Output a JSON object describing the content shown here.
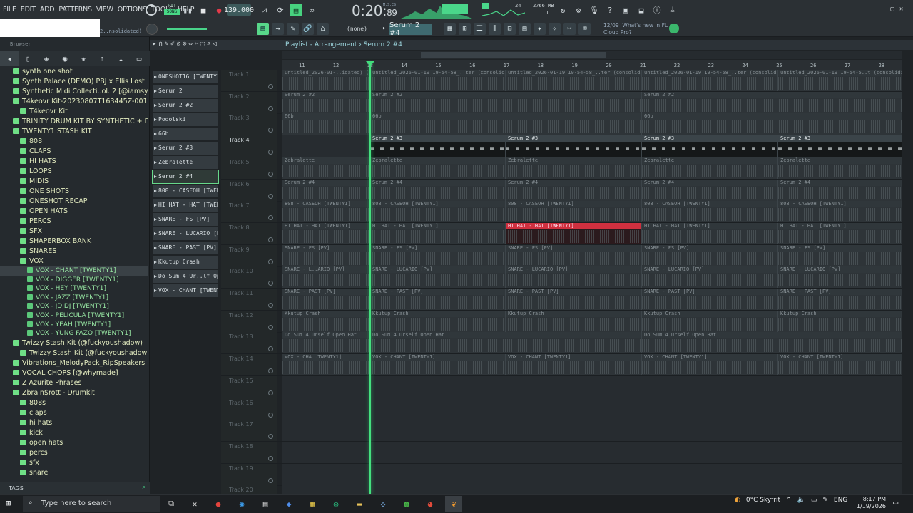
{
  "menu": [
    "FILE",
    "EDIT",
    "ADD",
    "PATTERNS",
    "VIEW",
    "OPTIONS",
    "TOOLS",
    "HELP"
  ],
  "transport": {
    "pat_label": "PAT",
    "song_label": "SONG",
    "tempo": "139.000",
    "time_main": "0:20",
    "time_sub": "89",
    "time_unit": "M:S:CS",
    "cpu_value": "24",
    "ram": "2766 MB",
    "voices": "1"
  },
  "pattern": {
    "selected": "Serum 2 #4",
    "none_label": "(none)"
  },
  "news": {
    "date": "12/09",
    "line1": "What's new in FL",
    "line2": "Cloud Pro?"
  },
  "browser": {
    "title": "Browser",
    "partial_text": "2..nsolidated)",
    "tags_label": "TAGS",
    "items": [
      {
        "label": "synth one shot",
        "indent": 1,
        "type": "folder"
      },
      {
        "label": "Synth Palace (DEMO) PBJ x Ellis Lost",
        "indent": 1,
        "type": "folder"
      },
      {
        "label": "Synthetic Midi Collecti..ol. 2 [@iamsynthetic]",
        "indent": 1,
        "type": "folder"
      },
      {
        "label": "T4keovr Kit-20230807T163445Z-001",
        "indent": 1,
        "type": "folder"
      },
      {
        "label": "T4keovr Kit",
        "indent": 2,
        "type": "folder"
      },
      {
        "label": "TRINITY DRUM KIT BY SYNTHETIC + DYNOX",
        "indent": 1,
        "type": "folder"
      },
      {
        "label": "TWENTY1 STASH KIT",
        "indent": 1,
        "type": "folder"
      },
      {
        "label": "808",
        "indent": 2,
        "type": "folder"
      },
      {
        "label": "CLAPS",
        "indent": 2,
        "type": "folder"
      },
      {
        "label": "HI HATS",
        "indent": 2,
        "type": "folder"
      },
      {
        "label": "LOOPS",
        "indent": 2,
        "type": "folder"
      },
      {
        "label": "MIDIS",
        "indent": 2,
        "type": "folder"
      },
      {
        "label": "ONE SHOTS",
        "indent": 2,
        "type": "folder"
      },
      {
        "label": "ONESHOT RECAP",
        "indent": 2,
        "type": "folder"
      },
      {
        "label": "OPEN HATS",
        "indent": 2,
        "type": "folder"
      },
      {
        "label": "PERCS",
        "indent": 2,
        "type": "folder"
      },
      {
        "label": "SFX",
        "indent": 2,
        "type": "folder"
      },
      {
        "label": "SHAPERBOX BANK",
        "indent": 2,
        "type": "folder"
      },
      {
        "label": "SNARES",
        "indent": 2,
        "type": "folder"
      },
      {
        "label": "VOX",
        "indent": 2,
        "type": "folder"
      },
      {
        "label": "VOX - CHANT [TWENTY1]",
        "indent": 3,
        "type": "file",
        "selected": true
      },
      {
        "label": "VOX - DIGGER [TWENTY1]",
        "indent": 3,
        "type": "file"
      },
      {
        "label": "VOX - HEY [TWENTY1]",
        "indent": 3,
        "type": "file"
      },
      {
        "label": "VOX - JAZZ [TWENTY1]",
        "indent": 3,
        "type": "file"
      },
      {
        "label": "VOX - JDJDJ [TWENTY1]",
        "indent": 3,
        "type": "file"
      },
      {
        "label": "VOX - PELICULA [TWENTY1]",
        "indent": 3,
        "type": "file"
      },
      {
        "label": "VOX - YEAH [TWENTY1]",
        "indent": 3,
        "type": "file"
      },
      {
        "label": "VOX - YUNG FAZO [TWENTY1]",
        "indent": 3,
        "type": "file"
      },
      {
        "label": "Twizzy Stash Kit (@fuckyoushadow)",
        "indent": 1,
        "type": "folder"
      },
      {
        "label": "Twizzy Stash Kit (@fuckyoushadow)",
        "indent": 2,
        "type": "folder"
      },
      {
        "label": "Vibrations_MelodyPack_RipSpeakers",
        "indent": 1,
        "type": "folder"
      },
      {
        "label": "VOCAL CHOPS [@whymade]",
        "indent": 1,
        "type": "folder"
      },
      {
        "label": "Z Azurite Phrases",
        "indent": 1,
        "type": "folder"
      },
      {
        "label": "Zbrain$rott - Drumkit",
        "indent": 1,
        "type": "folder"
      },
      {
        "label": "808s",
        "indent": 2,
        "type": "folder"
      },
      {
        "label": "claps",
        "indent": 2,
        "type": "folder"
      },
      {
        "label": "hi hats",
        "indent": 2,
        "type": "folder"
      },
      {
        "label": "kick",
        "indent": 2,
        "type": "folder"
      },
      {
        "label": "open hats",
        "indent": 2,
        "type": "folder"
      },
      {
        "label": "percs",
        "indent": 2,
        "type": "folder"
      },
      {
        "label": "sfx",
        "indent": 2,
        "type": "folder"
      },
      {
        "label": "snare",
        "indent": 2,
        "type": "folder"
      }
    ]
  },
  "playlist": {
    "breadcrumb": "Playlist - Arrangement",
    "pattern": "Serum 2 #4",
    "ruler": [
      "11",
      "12",
      "13",
      "14",
      "15",
      "16",
      "17",
      "18",
      "19",
      "20",
      "21",
      "22",
      "23",
      "24",
      "25",
      "26",
      "27",
      "28"
    ],
    "channels": [
      "ONESHOT16 [TWENTY1]",
      "Serum 2",
      "Serum 2 #2",
      "Podolski",
      "66b",
      "Serum 2 #3",
      "Zebralette",
      "Serum 2 #4",
      "808 - CASEOH [TWENTY1]",
      "HI HAT - HAT [TWENTY1]",
      "SNARE - FS [PV]",
      "SNARE - LUCARIO [PV]",
      "SNARE - PAST [PV]",
      "Kkutup Crash",
      "Do Sum 4 Ur..lf Open Hat",
      "VOX - CHANT [TWENTY1]"
    ],
    "selected_channel": 7,
    "tracks": [
      {
        "name": "Track 1",
        "clips": [
          "untitled_2026-01-..idated) (pitch..",
          "untitled_2026-01-19 19-54-58_..ter (consolidated) (pitch 1)",
          "untitled_2026-01-19 19-54-58_..ter (consolidated) (pitch 1)",
          "untitled_2026-01-19 19-54-58_..ter (consolidated) (pitch 1)",
          "untitled_2026-01-19 19-54-5..t (consolidated)"
        ],
        "kind": "wave"
      },
      {
        "name": "Track 2",
        "clips": [
          "Serum 2 #2",
          "Serum 2 #2",
          "Serum 2 #2"
        ],
        "kind": "plain"
      },
      {
        "name": "Track 3",
        "clips": [
          "66b",
          "66b",
          "66b"
        ],
        "kind": "plain"
      },
      {
        "name": "Track 4",
        "clips": [
          "Serum 2 #3",
          "Serum 2 #3",
          "Serum 2 #3",
          "Serum 2 #3"
        ],
        "kind": "active"
      },
      {
        "name": "Track 5",
        "clips": [
          "Zebralette",
          "Zebralette",
          "Zebralette",
          "Zebralette",
          "Zebralette"
        ],
        "kind": "plain"
      },
      {
        "name": "Track 6",
        "clips": [
          "Serum 2 #4",
          "Serum 2 #4",
          "Serum 2 #4",
          "Serum 2 #4",
          "Serum 2 #4"
        ],
        "kind": "plain"
      },
      {
        "name": "Track 7",
        "clips": [
          "808 - CASEOH [TWENTY1]",
          "808 - CASEOH [TWENTY1]",
          "808 - CASEOH [TWENTY1]",
          "808 - CASEOH [TWENTY1]",
          "808 - CASEOH [TWENTY1]"
        ],
        "kind": "plain"
      },
      {
        "name": "Track 8",
        "clips": [
          "HI HAT - HAT [TWENTY1]",
          "HI HAT - HAT [TWENTY1]",
          "HI HAT - HAT [TWENTY1]",
          "HI HAT - HAT [TWENTY1]",
          "HI HAT - HAT [TWENTY1]"
        ],
        "kind": "red"
      },
      {
        "name": "Track 9",
        "clips": [
          "SNARE - FS [PV]",
          "SNARE - FS [PV]",
          "SNARE - FS [PV]",
          "SNARE - FS [PV]",
          "SNARE - FS [PV]"
        ],
        "kind": "plain"
      },
      {
        "name": "Track 10",
        "clips": [
          "SNARE - L..ARIO [PV]",
          "SNARE - LUCARIO [PV]",
          "SNARE - LUCARIO [PV]",
          "SNARE - LUCARIO [PV]",
          "SNARE - LUCARIO [PV]"
        ],
        "kind": "plain"
      },
      {
        "name": "Track 11",
        "clips": [
          "SNARE - PAST [PV]",
          "SNARE - PAST [PV]",
          "SNARE - PAST [PV]",
          "SNARE - PAST [PV]",
          "SNARE - PAST [PV]"
        ],
        "kind": "plain"
      },
      {
        "name": "Track 12",
        "clips": [
          "Kkutup Crash",
          "Kkutup Crash",
          "Kkutup Crash",
          "Kkutup Crash",
          "Kkutup Crash"
        ],
        "kind": "plain"
      },
      {
        "name": "Track 13",
        "clips": [
          "Do Sum 4 Urself Open Hat",
          "Do Sum 4 Urself Open Hat",
          "Do Sum 4 Urself Open Hat"
        ],
        "kind": "plain"
      },
      {
        "name": "Track 14",
        "clips": [
          "VOX - CHA..TWENTY1]",
          "VOX - CHANT [TWENTY1]",
          "VOX - CHANT [TWENTY1]",
          "VOX - CHANT [TWENTY1]",
          "VOX - CHANT [TWENTY1]"
        ],
        "kind": "plain"
      },
      {
        "name": "Track 15",
        "clips": [],
        "kind": "plain"
      },
      {
        "name": "Track 16",
        "clips": [],
        "kind": "plain"
      },
      {
        "name": "Track 17",
        "clips": [],
        "kind": "plain"
      },
      {
        "name": "Track 18",
        "clips": [],
        "kind": "plain"
      },
      {
        "name": "Track 19",
        "clips": [],
        "kind": "plain"
      },
      {
        "name": "Track 20",
        "clips": [],
        "kind": "plain"
      }
    ]
  },
  "taskbar": {
    "search_placeholder": "Type here to search",
    "weather": "0°C  Skyfrit",
    "lang": "ENG",
    "time": "8:17 PM",
    "date": "1/19/2026"
  }
}
